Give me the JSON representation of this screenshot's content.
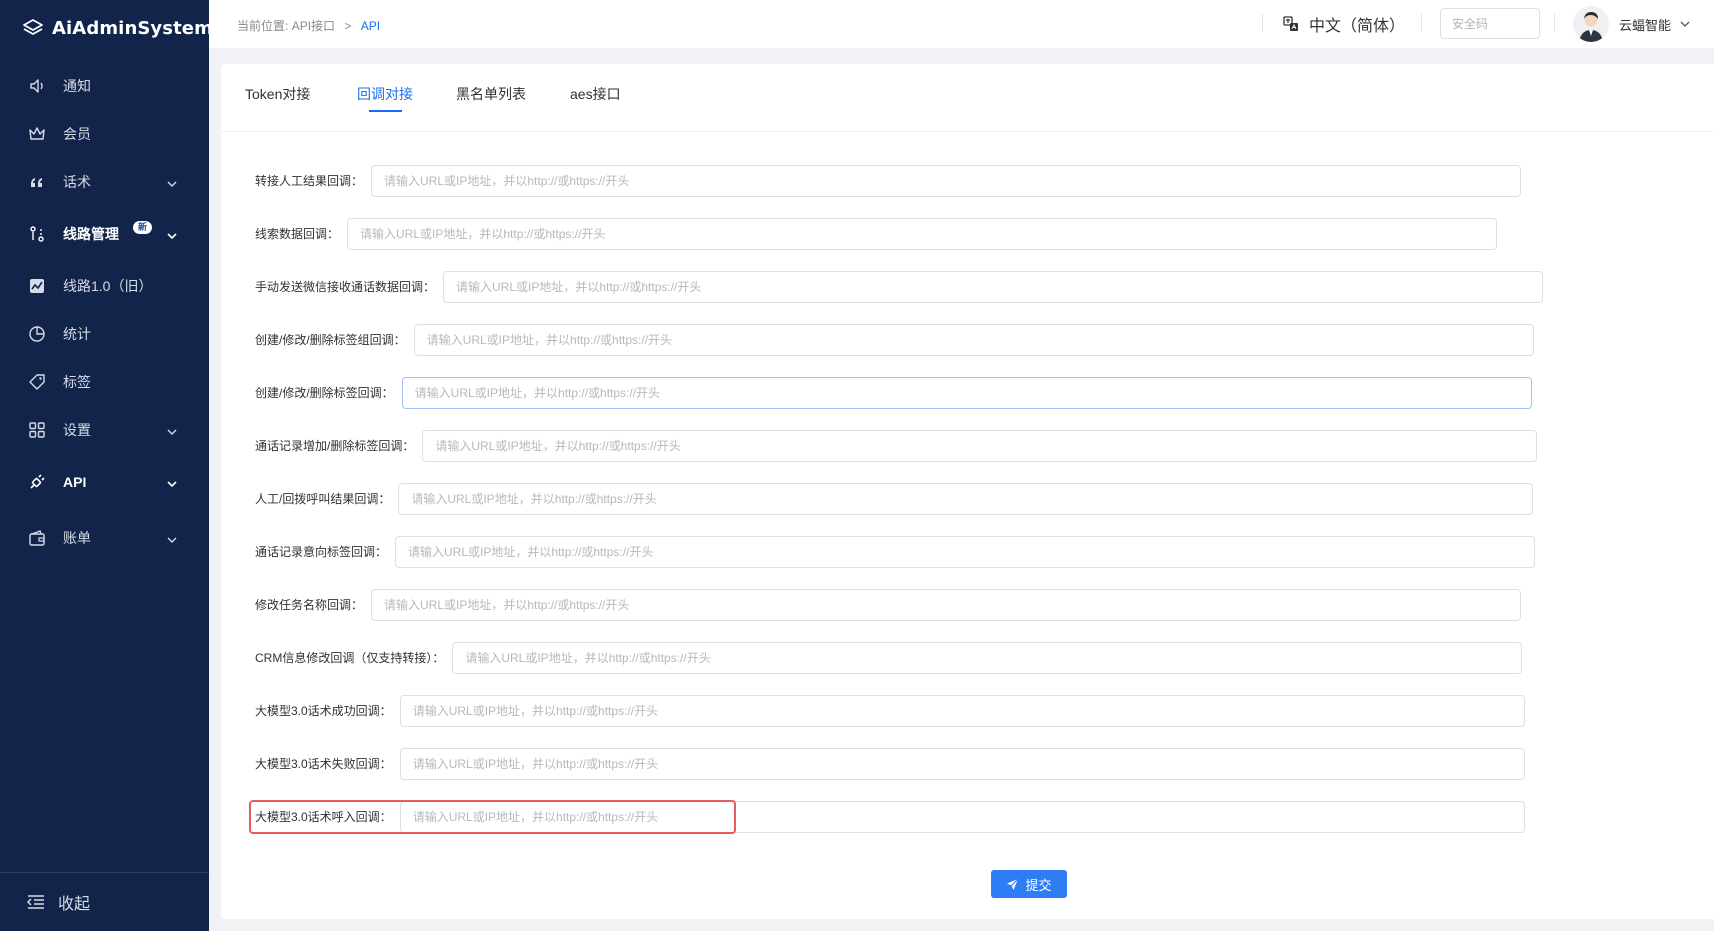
{
  "app": {
    "title": "AiAdminSystem"
  },
  "sidebar": {
    "items": [
      {
        "label": "通知",
        "icon": "speaker-icon"
      },
      {
        "label": "会员",
        "icon": "crown-icon"
      },
      {
        "label": "话术",
        "icon": "quote-icon"
      },
      {
        "label": "线路管理",
        "icon": "route-icon",
        "badge": "新"
      },
      {
        "label": "线路1.0（旧）",
        "icon": "chart-box-icon"
      },
      {
        "label": "统计",
        "icon": "pie-icon"
      },
      {
        "label": "标签",
        "icon": "tag-icon"
      },
      {
        "label": "设置",
        "icon": "grid-icon"
      },
      {
        "label": "API",
        "icon": "plug-icon"
      },
      {
        "label": "账单",
        "icon": "wallet-icon"
      }
    ],
    "collapse_label": "收起"
  },
  "header": {
    "breadcrumb_prefix": "当前位置:",
    "breadcrumb_parent": "API接口",
    "breadcrumb_sep": ">",
    "breadcrumb_current": "API",
    "language": "中文（简体）",
    "security_placeholder": "安全码",
    "username": "云蝠智能"
  },
  "tabs": [
    {
      "label": "Token对接"
    },
    {
      "label": "回调对接"
    },
    {
      "label": "黑名单列表"
    },
    {
      "label": "aes接口"
    }
  ],
  "active_tab": "回调对接",
  "form": {
    "placeholder": "请输入URL或IP地址，并以http://或https://开头",
    "fields": [
      {
        "label": "转接人工结果回调：",
        "value": ""
      },
      {
        "label": "线索数据回调：",
        "value": ""
      },
      {
        "label": "手动发送微信接收通话数据回调：",
        "value": ""
      },
      {
        "label": "创建/修改/删除标签组回调：",
        "value": ""
      },
      {
        "label": "创建/修改/删除标签回调：",
        "value": ""
      },
      {
        "label": "通话记录增加/删除标签回调：",
        "value": ""
      },
      {
        "label": "人工/回拨呼叫结果回调：",
        "value": ""
      },
      {
        "label": "通话记录意向标签回调：",
        "value": ""
      },
      {
        "label": "修改任务名称回调：",
        "value": ""
      },
      {
        "label": "CRM信息修改回调（仅支持转接）：",
        "value": ""
      },
      {
        "label": "大模型3.0话术成功回调：",
        "value": ""
      },
      {
        "label": "大模型3.0话术失败回调：",
        "value": ""
      },
      {
        "label": "大模型3.0话术呼入回调：",
        "value": ""
      }
    ],
    "submit_label": "提交"
  },
  "colors": {
    "sidebar_bg": "#13244b",
    "accent": "#1a6ef5",
    "highlight": "#e45c5c"
  }
}
